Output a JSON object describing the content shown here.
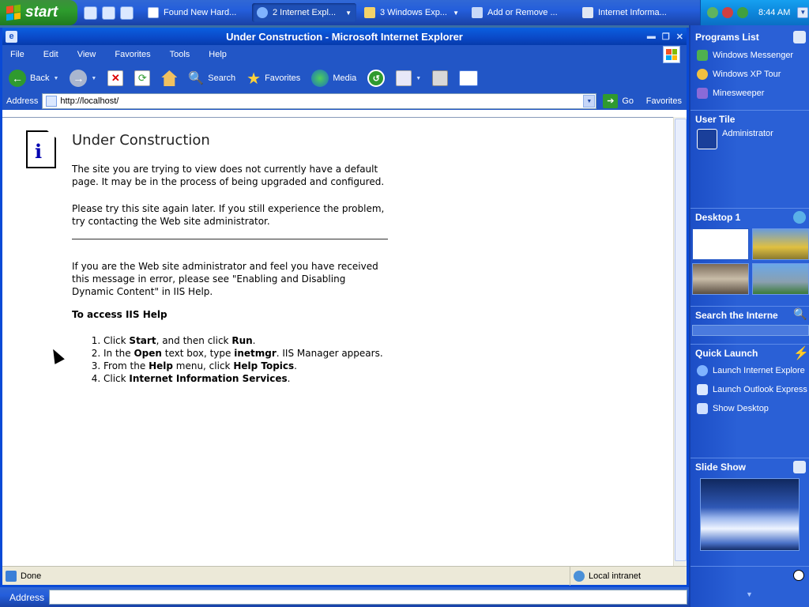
{
  "taskbar": {
    "start_label": "start",
    "tasks": [
      {
        "label": "Found New Hard..."
      },
      {
        "label": "2 Internet Expl..."
      },
      {
        "label": "3 Windows Exp..."
      },
      {
        "label": "Add or Remove ..."
      },
      {
        "label": "Internet Informa..."
      }
    ],
    "clock": "8:44 AM"
  },
  "window": {
    "title": "Under Construction - Microsoft Internet Explorer",
    "menu": [
      "File",
      "Edit",
      "View",
      "Favorites",
      "Tools",
      "Help"
    ],
    "toolbar": {
      "back": "Back",
      "search": "Search",
      "favorites": "Favorites",
      "media": "Media"
    },
    "address": {
      "label": "Address",
      "url": "http://localhost/",
      "go": "Go",
      "favorites_link": "Favorites"
    }
  },
  "page": {
    "heading": "Under Construction",
    "para1": "The site you are trying to view does not currently have a default page. It may be in the process of being upgraded and configured.",
    "para2": "Please try this site again later. If you still experience the problem, try contacting the Web site administrator.",
    "para3": "If you are the Web site administrator and feel you have received this message in error, please see \"Enabling and Disabling Dynamic Content\" in IIS Help.",
    "help_heading": "To access IIS Help",
    "steps": [
      {
        "a": "Click ",
        "b1": "Start",
        "c": ", and then click ",
        "b2": "Run",
        "d": "."
      },
      {
        "a": "In the ",
        "b1": "Open",
        "c": " text box, type ",
        "b2": "inetmgr",
        "d": ". IIS Manager appears."
      },
      {
        "a": "From the ",
        "b1": "Help",
        "c": " menu, click ",
        "b2": "Help Topics",
        "d": "."
      },
      {
        "a": "Click ",
        "b1": "Internet Information Services",
        "c": "",
        "b2": "",
        "d": "."
      }
    ]
  },
  "status": {
    "text": "Done",
    "zone": "Local intranet"
  },
  "deskbar": {
    "label": "Address"
  },
  "sidebar": {
    "programs_title": "Programs List",
    "programs": [
      "Windows Messenger",
      "Windows XP Tour",
      "Minesweeper"
    ],
    "user_title": "User Tile",
    "user_name": "Administrator",
    "desktop_title": "Desktop 1",
    "search_title": "Search the Interne",
    "quick_title": "Quick Launch",
    "quick": [
      "Launch Internet Explore",
      "Launch Outlook Express",
      "Show Desktop"
    ],
    "slide_title": "Slide Show"
  },
  "colors": {
    "xp_blue": "#245edb",
    "start_green": "#2e9c2e",
    "ie_toolbar": "#2256c6",
    "link_blue": "#0000b0"
  }
}
